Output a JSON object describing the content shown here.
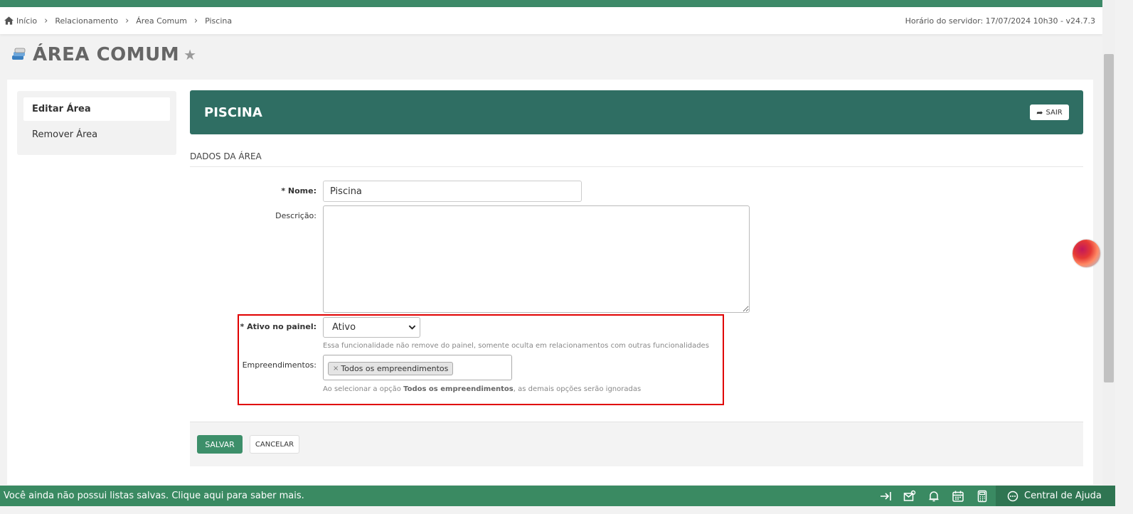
{
  "breadcrumb": {
    "home": "Início",
    "items": [
      "Relacionamento",
      "Área Comum",
      "Piscina"
    ]
  },
  "server_time": "Horário do servidor: 17/07/2024 10h30 - v24.7.3",
  "page": {
    "title": "ÁREA COMUM"
  },
  "side_menu": {
    "items": [
      "Editar Área",
      "Remover Área"
    ]
  },
  "card": {
    "title": "PISCINA",
    "exit_label": "SAIR"
  },
  "section": {
    "title": "DADOS DA ÁREA"
  },
  "form": {
    "name_label": "Nome:",
    "name_value": "Piscina",
    "description_label": "Descrição:",
    "description_value": "",
    "active_label": "Ativo no painel:",
    "active_value": "Ativo",
    "active_help": "Essa funcionalidade não remove do painel, somente oculta em relacionamentos com outras funcionalidades",
    "developments_label": "Empreendimentos:",
    "developments_tag": "Todos os empreendimentos",
    "developments_help_prefix": "Ao selecionar a opção ",
    "developments_help_bold": "Todos os empreendimentos",
    "developments_help_suffix": ", as demais opções serão ignoradas"
  },
  "actions": {
    "save_label": "SALVAR",
    "cancel_label": "CANCELAR"
  },
  "bottom_bar": {
    "message": "Você ainda não possui listas salvas. Clique aqui para saber mais.",
    "help_center": "Central de Ajuda"
  },
  "colors": {
    "brand_green": "#3a8a62",
    "header_teal": "#2f6e63",
    "highlight_red": "#e00000"
  }
}
